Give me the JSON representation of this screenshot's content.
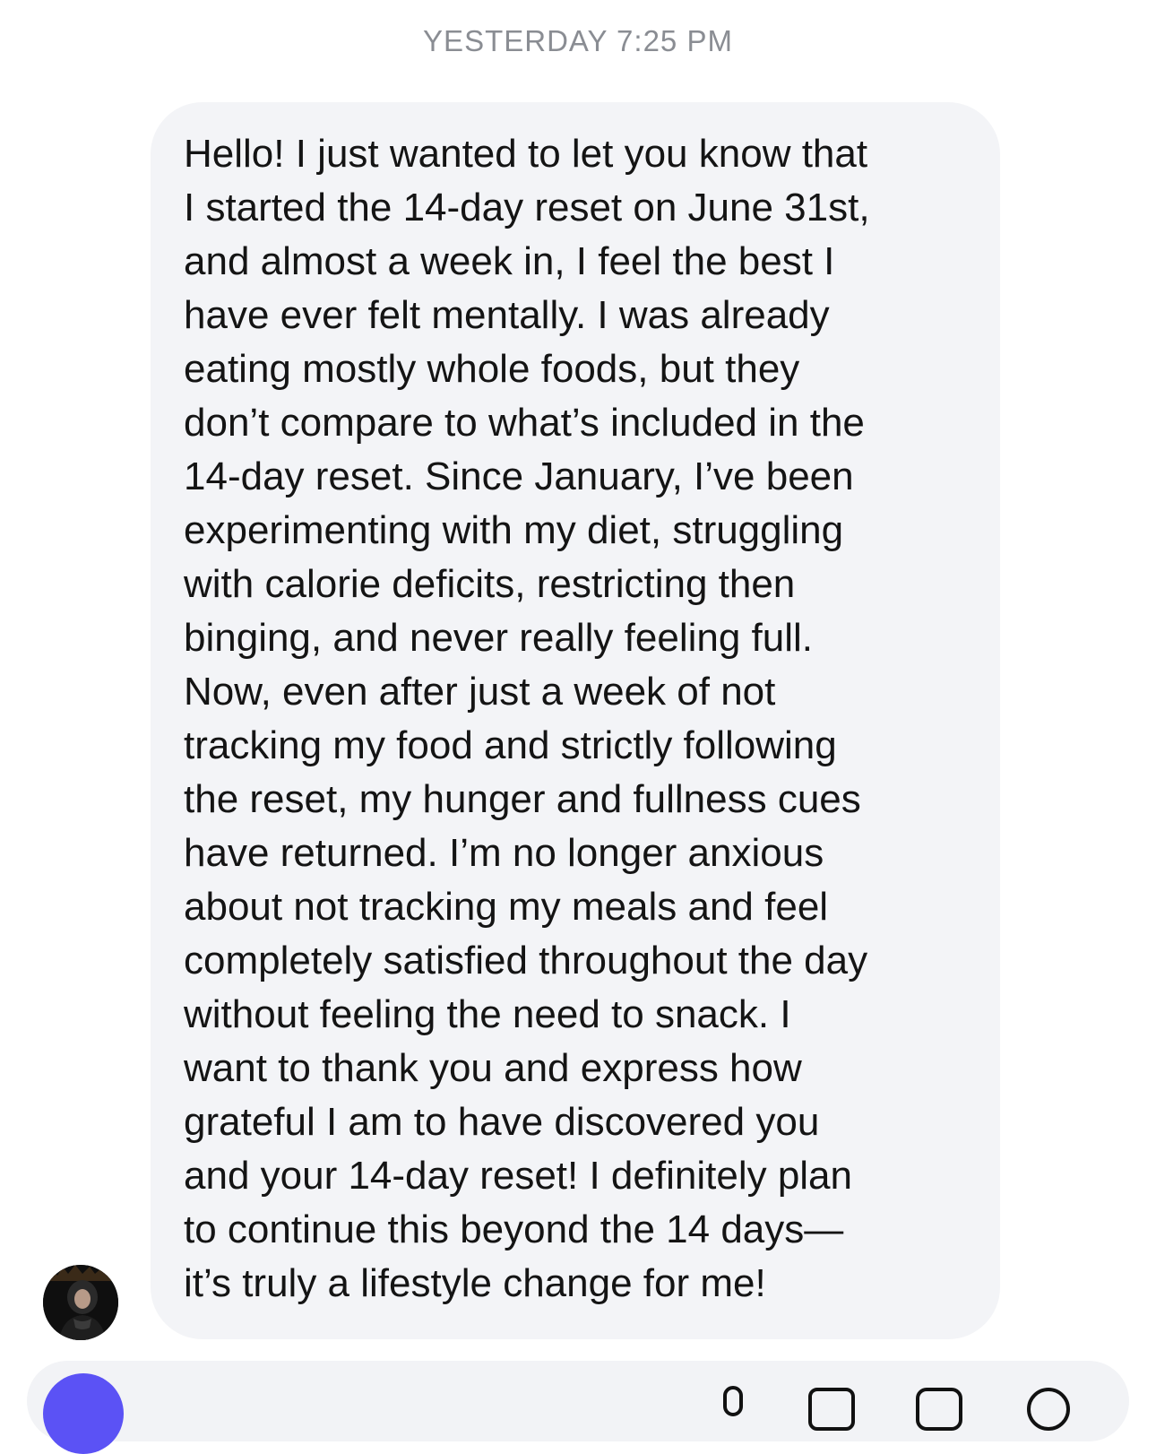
{
  "conversation": {
    "timestamp": "YESTERDAY 7:25 PM",
    "message": {
      "lines": [
        "Hello! I just wanted to let you know that",
        "I started the 14-day reset on June 31st,",
        "and almost a week in, I feel the best I",
        "have ever felt mentally. I was already",
        "eating mostly whole foods, but they",
        "don’t compare to what’s included in the",
        "14-day reset. Since January, I’ve been",
        "experimenting with my diet, struggling",
        "with calorie deficits, restricting then",
        "binging, and never really feeling full.",
        "Now, even after just a week of not",
        "tracking my food and strictly following",
        "the reset, my hunger and fullness cues",
        "have returned. I’m no longer anxious",
        "about not tracking my meals and feel",
        "completely satisfied throughout the day",
        "without feeling the need to snack. I",
        "want to thank you and express how",
        "grateful I am to have discovered you",
        "and your 14-day reset! I definitely plan",
        "to continue this beyond the 14 days—",
        "it’s truly a lifestyle change for me!"
      ]
    }
  },
  "composer": {
    "icons": [
      "plus-icon",
      "microphone-icon",
      "image-icon",
      "sticker-icon",
      "emoji-icon"
    ]
  },
  "colors": {
    "bubble": "#f3f4f7",
    "text": "#141414",
    "timestamp": "#8a8d93",
    "accent": "#5b52f5"
  }
}
